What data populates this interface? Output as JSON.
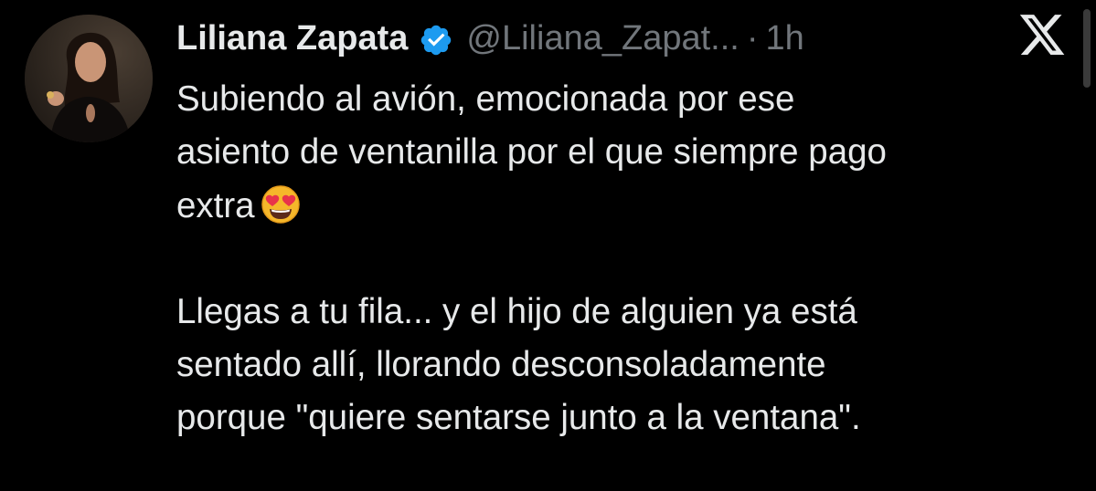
{
  "tweet": {
    "author": {
      "display_name": "Liliana Zapata",
      "handle": "@Liliana_Zapat...",
      "verified": true,
      "avatar_icon": "profile-photo"
    },
    "separator": "·",
    "timestamp": "1h",
    "brand_icon": "x-logo-icon",
    "paragraphs": [
      {
        "text": "Subiendo al avión, emocionada por ese\nasiento de ventanilla por el que siempre pago\nextra",
        "emoji": "heart-eyes-emoji"
      },
      {
        "text": "Llegas a tu fila... y el hijo de alguien ya está\nsentado allí, llorando desconsoladamente\nporque \"quiere sentarse junto a la ventana\"."
      }
    ]
  },
  "colors": {
    "background": "#000000",
    "text_primary": "#e7e9ea",
    "text_secondary": "#71767b",
    "verified_badge": "#1d9bf0"
  }
}
